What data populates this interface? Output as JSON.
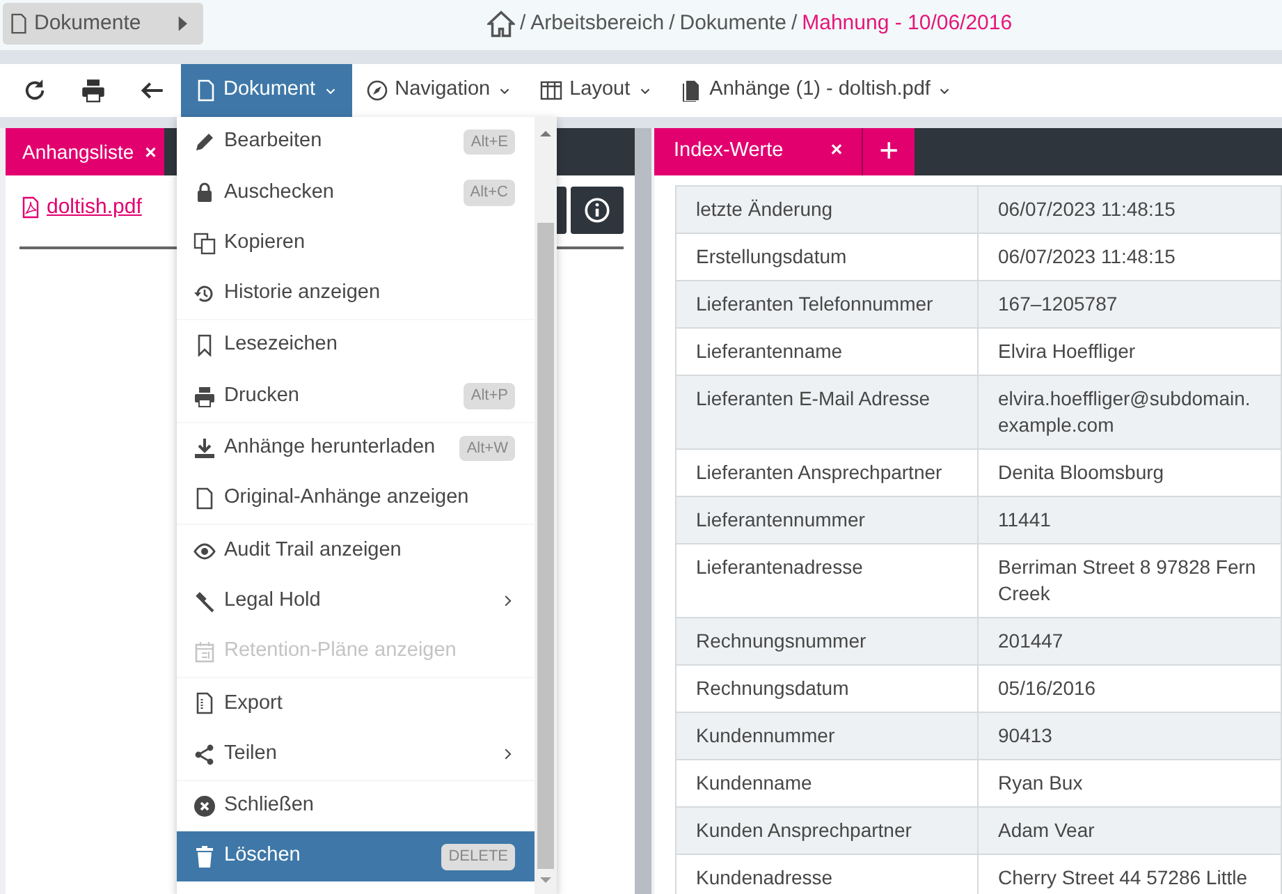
{
  "header": {
    "folder_button": "Dokumente",
    "separator": "/",
    "breadcrumb": [
      {
        "label": "Arbeitsbereich",
        "current": false
      },
      {
        "label": "Dokumente",
        "current": false
      },
      {
        "label": "Mahnung - 10/06/2016",
        "current": true
      }
    ]
  },
  "toolbar": {
    "menus": [
      {
        "label": "Dokument",
        "selected": true
      },
      {
        "label": "Navigation",
        "selected": false
      },
      {
        "label": "Layout",
        "selected": false
      },
      {
        "label": "Anhänge (1) - doltish.pdf",
        "selected": false
      }
    ]
  },
  "document_menu": {
    "groups": [
      [
        {
          "label": "Bearbeiten",
          "shortcut": "Alt+E",
          "disabled": false,
          "submenu": false,
          "selected": false
        },
        {
          "label": "Auschecken",
          "shortcut": "Alt+C",
          "disabled": false,
          "submenu": false,
          "selected": false
        },
        {
          "label": "Kopieren",
          "disabled": false,
          "submenu": false,
          "selected": false
        },
        {
          "label": "Historie anzeigen",
          "disabled": false,
          "submenu": false,
          "selected": false
        }
      ],
      [
        {
          "label": "Lesezeichen",
          "disabled": false,
          "submenu": false,
          "selected": false
        },
        {
          "label": "Drucken",
          "shortcut": "Alt+P",
          "disabled": false,
          "submenu": false,
          "selected": false
        }
      ],
      [
        {
          "label": "Anhänge herunterladen",
          "shortcut": "Alt+W",
          "disabled": false,
          "submenu": false,
          "selected": false
        },
        {
          "label": "Original-Anhänge anzeigen",
          "disabled": false,
          "submenu": false,
          "selected": false
        }
      ],
      [
        {
          "label": "Audit Trail anzeigen",
          "disabled": false,
          "submenu": false,
          "selected": false
        },
        {
          "label": "Legal Hold",
          "disabled": false,
          "submenu": true,
          "selected": false
        },
        {
          "label": "Retention-Pläne anzeigen",
          "disabled": true,
          "submenu": false,
          "selected": false
        }
      ],
      [
        {
          "label": "Export",
          "disabled": false,
          "submenu": false,
          "selected": false
        },
        {
          "label": "Teilen",
          "disabled": false,
          "submenu": true,
          "selected": false
        }
      ],
      [
        {
          "label": "Schließen",
          "disabled": false,
          "submenu": false,
          "selected": false
        },
        {
          "label": "Löschen",
          "shortcut": "DELETE",
          "disabled": false,
          "submenu": false,
          "selected": true
        }
      ]
    ]
  },
  "attachments_panel": {
    "tab": {
      "label": "Anhangsliste",
      "close": "×"
    },
    "files": [
      "doltish.pdf"
    ]
  },
  "index_panel": {
    "tab": {
      "label": "Index-Werte",
      "close": "×"
    },
    "add": "+",
    "rows": [
      {
        "name": "letzte Änderung",
        "value": "06/07/2023 11:48:15"
      },
      {
        "name": "Erstellungsdatum",
        "value": "06/07/2023 11:48:15"
      },
      {
        "name": "Lieferanten Telefonnummer",
        "value": "167–1205787"
      },
      {
        "name": "Lieferantenname",
        "value": "Elvira Hoeffliger"
      },
      {
        "name": "Lieferanten E-Mail Adresse",
        "value": "elvira.hoeffliger@subdomain.example.com"
      },
      {
        "name": "Lieferanten Ansprechpartner",
        "value": "Denita Bloomsburg"
      },
      {
        "name": "Lieferantennummer",
        "value": "11441"
      },
      {
        "name": "Lieferantenadresse",
        "value": "Berriman Street 8 97828 Fern Creek"
      },
      {
        "name": "Rechnungsnummer",
        "value": "201447"
      },
      {
        "name": "Rechnungsdatum",
        "value": "05/16/2016"
      },
      {
        "name": "Kundennummer",
        "value": "90413"
      },
      {
        "name": "Kundenname",
        "value": "Ryan Bux"
      },
      {
        "name": "Kunden Ansprechpartner",
        "value": "Adam Vear"
      },
      {
        "name": "Kundenadresse",
        "value": "Cherry Street 44 57286 Little"
      }
    ]
  }
}
